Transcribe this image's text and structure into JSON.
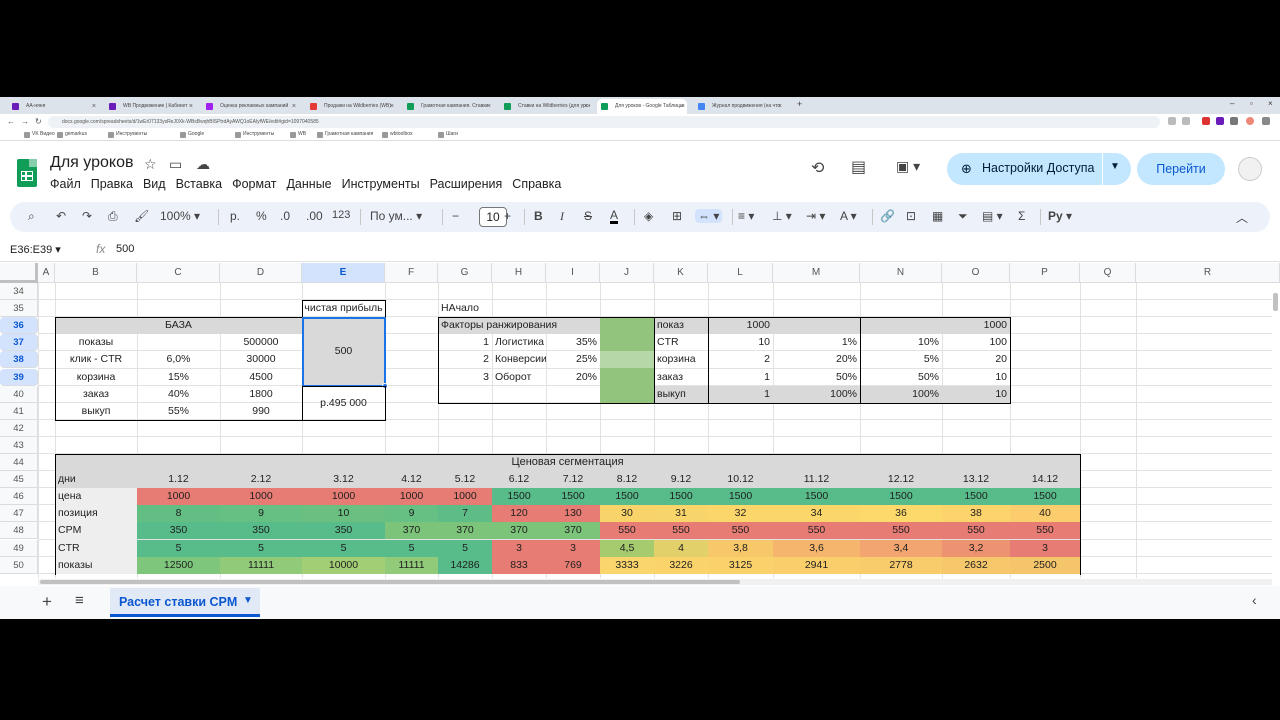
{
  "browser": {
    "tabs": [
      {
        "label": "AA-няня",
        "color": "#6a1bb9"
      },
      {
        "label": "WB Продвижение | Кабинет",
        "color": "#6a1bb9"
      },
      {
        "label": "Оценка рекламных кампаний",
        "color": "#a020f0"
      },
      {
        "label": "Продажи на Wildberries (WB)",
        "color": "#e53935"
      },
      {
        "label": "Грамотная кампания. Ставки",
        "color": "#0f9d58"
      },
      {
        "label": "Ставки на Wildberries (для уроков)",
        "color": "#0f9d58"
      },
      {
        "label": "Для уроков - Google Таблицы",
        "color": "#0f9d58"
      },
      {
        "label": "Журнал продвижения (на что",
        "color": "#4285f4"
      }
    ],
    "url": "docs.google.com/spreadsheets/d/1wEr07133ysReJ0Xk-WBsBwqhBlSPtrdAyAWQ1oEAlyfWE/edit#gid=1097040585"
  },
  "bookmarks": [
    "VK Видео",
    "gemarkus",
    "Инструменты",
    "Google",
    "Инструменты",
    "WB",
    "Грамотная кампания",
    "wbtoolbox",
    "Шаги"
  ],
  "app": {
    "title": "Для уроков",
    "menu": [
      "Файл",
      "Правка",
      "Вид",
      "Вставка",
      "Формат",
      "Данные",
      "Инструменты",
      "Расширения",
      "Справка"
    ],
    "access_label": "Настройки Доступа",
    "go_label": "Перейти"
  },
  "toolbar": {
    "zoom": "100%",
    "currency": "р.",
    "percent": "%",
    "dec_minus": ".0",
    "dec_plus": ".00",
    "num123": "123",
    "font": "По ум...",
    "font_size": "10"
  },
  "formula": {
    "namebox": "E36:E39",
    "value": "500"
  },
  "columns": [
    "A",
    "B",
    "C",
    "D",
    "E",
    "F",
    "G",
    "H",
    "I",
    "J",
    "K",
    "L",
    "M",
    "N",
    "O",
    "P",
    "Q",
    "R"
  ],
  "rows": [
    "34",
    "35",
    "36",
    "37",
    "38",
    "39",
    "40",
    "41",
    "42",
    "43",
    "44",
    "45",
    "46",
    "47",
    "48",
    "49",
    "50"
  ],
  "base": {
    "title": "БАЗА",
    "rows": [
      {
        "label": "показы",
        "pct": "",
        "val": "500000"
      },
      {
        "label": "клик - CTR",
        "pct": "6,0%",
        "val": "30000"
      },
      {
        "label": "корзина",
        "pct": "15%",
        "val": "4500"
      },
      {
        "label": "заказ",
        "pct": "40%",
        "val": "1800"
      },
      {
        "label": "выкуп",
        "pct": "55%",
        "val": "990"
      }
    ],
    "profit_label": "чистая прибыль",
    "profit_value": "500",
    "profit_total": "р.495 000"
  },
  "start": {
    "title": "НАчало",
    "factors_label": "Факторы ранжирования",
    "factors": [
      {
        "n": "1",
        "name": "Логистика",
        "pct": "35%"
      },
      {
        "n": "2",
        "name": "Конверсии",
        "pct": "25%"
      },
      {
        "n": "3",
        "name": "Оборот",
        "pct": "20%"
      }
    ],
    "metrics": [
      {
        "label": "показ",
        "l": "1000",
        "m": "",
        "n": "",
        "o": "1000"
      },
      {
        "label": "CTR",
        "l": "10",
        "m": "1%",
        "n": "10%",
        "o": "100"
      },
      {
        "label": "корзина",
        "l": "2",
        "m": "20%",
        "n": "5%",
        "o": "20"
      },
      {
        "label": "заказ",
        "l": "1",
        "m": "50%",
        "n": "50%",
        "o": "10"
      },
      {
        "label": "выкуп",
        "l": "1",
        "m": "100%",
        "n": "100%",
        "o": "10"
      }
    ]
  },
  "segmentation": {
    "title": "Ценовая сегментация",
    "days_label": "дни",
    "days": [
      "1.12",
      "2.12",
      "3.12",
      "4.12",
      "5.12",
      "6.12",
      "7.12",
      "8.12",
      "9.12",
      "10.12",
      "11.12",
      "12.12",
      "13.12",
      "14.12"
    ],
    "rows": [
      {
        "label": "цена",
        "values": [
          "1000",
          "1000",
          "1000",
          "1000",
          "1000",
          "1500",
          "1500",
          "1500",
          "1500",
          "1500",
          "1500",
          "1500",
          "1500",
          "1500"
        ],
        "colors": [
          "#e67c73",
          "#e67c73",
          "#e67c73",
          "#e67c73",
          "#e67c73",
          "#57bb8a",
          "#57bb8a",
          "#57bb8a",
          "#57bb8a",
          "#57bb8a",
          "#57bb8a",
          "#57bb8a",
          "#57bb8a",
          "#57bb8a"
        ]
      },
      {
        "label": "позиция",
        "values": [
          "8",
          "9",
          "10",
          "9",
          "7",
          "120",
          "130",
          "30",
          "31",
          "32",
          "34",
          "36",
          "38",
          "40"
        ],
        "colors": [
          "#63be84",
          "#66bf83",
          "#6bc081",
          "#66bf83",
          "#5ebc86",
          "#e67c73",
          "#e67c73",
          "#f7d36a",
          "#f8d56a",
          "#fad66b",
          "#fbd76b",
          "#fdd86b",
          "#fdd36c",
          "#fccd6c"
        ]
      },
      {
        "label": "CPM",
        "values": [
          "350",
          "350",
          "350",
          "370",
          "370",
          "370",
          "370",
          "550",
          "550",
          "550",
          "550",
          "550",
          "550",
          "550"
        ],
        "colors": [
          "#57bb8a",
          "#57bb8a",
          "#57bb8a",
          "#7cc47a",
          "#7cc47a",
          "#7cc47a",
          "#7cc47a",
          "#e67c73",
          "#e67c73",
          "#e67c73",
          "#e67c73",
          "#e67c73",
          "#e67c73",
          "#e67c73"
        ]
      },
      {
        "label": "CTR",
        "values": [
          "5",
          "5",
          "5",
          "5",
          "5",
          "3",
          "3",
          "4,5",
          "4",
          "3,8",
          "3,6",
          "3,4",
          "3,2",
          "3"
        ],
        "colors": [
          "#57bb8a",
          "#57bb8a",
          "#57bb8a",
          "#57bb8a",
          "#57bb8a",
          "#e67c73",
          "#e67c73",
          "#a6cb6f",
          "#e2d06a",
          "#f7c869",
          "#f6b56d",
          "#f2a570",
          "#ee9371",
          "#e67c73"
        ]
      },
      {
        "label": "показы",
        "values": [
          "12500",
          "11111",
          "10000",
          "11111",
          "14286",
          "833",
          "769",
          "3333",
          "3226",
          "3125",
          "2941",
          "2778",
          "2632",
          "2500"
        ],
        "colors": [
          "#7ec67b",
          "#91ca78",
          "#a2ce75",
          "#91ca78",
          "#57bb8a",
          "#e67c73",
          "#e67c73",
          "#fad56b",
          "#fad46b",
          "#fad16b",
          "#f9ce6b",
          "#f8cb6b",
          "#f7c76b",
          "#f5c56b"
        ]
      }
    ]
  }
}
